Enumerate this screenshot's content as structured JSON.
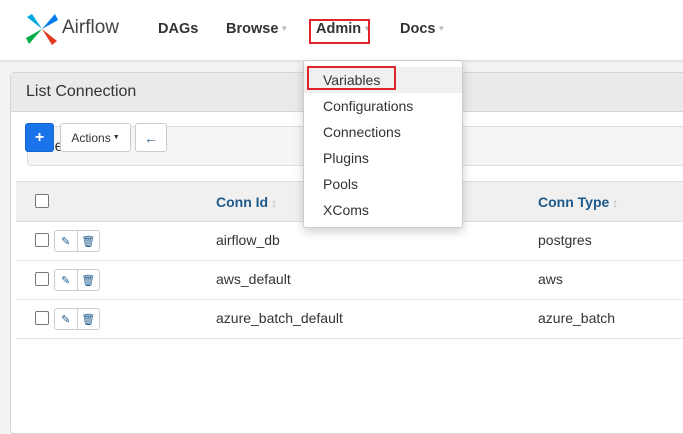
{
  "navbar": {
    "brand": "Airflow",
    "items": [
      {
        "label": "DAGs"
      },
      {
        "label": "Browse"
      },
      {
        "label": "Admin"
      },
      {
        "label": "Docs"
      }
    ]
  },
  "admin_menu": {
    "items": [
      "Variables",
      "Configurations",
      "Connections",
      "Plugins",
      "Pools",
      "XComs"
    ],
    "highlighted": "Variables"
  },
  "panel": {
    "title": "List Connection",
    "search_label": "Search"
  },
  "toolbar": {
    "add_label": "+",
    "actions_label": "Actions",
    "back_label": "←"
  },
  "table": {
    "columns": [
      "Conn Id",
      "Conn Type"
    ],
    "rows": [
      {
        "conn_id": "airflow_db",
        "conn_type": "postgres"
      },
      {
        "conn_id": "aws_default",
        "conn_type": "aws"
      },
      {
        "conn_id": "azure_batch_default",
        "conn_type": "azure_batch"
      }
    ]
  },
  "icons": {
    "logo": "airflow-pinwheel-icon",
    "edit": "edit-icon",
    "delete": "trash-icon",
    "sort": "sort-icon",
    "caret": "caret-down-icon"
  },
  "colors": {
    "highlight_border": "#e0232a",
    "link_blue": "#1d5a8c",
    "primary_button": "#1a73e8"
  }
}
